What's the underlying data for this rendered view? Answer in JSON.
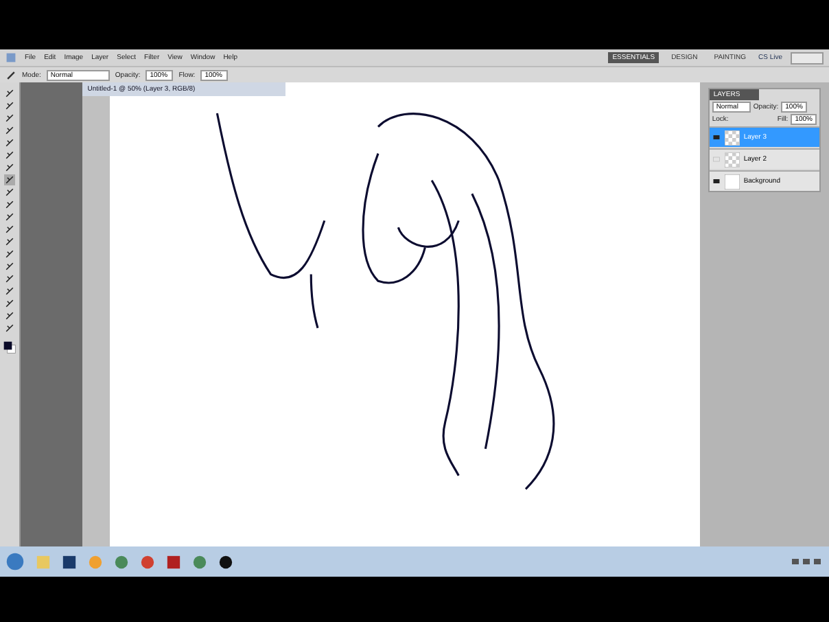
{
  "menu": [
    "File",
    "Edit",
    "Image",
    "Layer",
    "Select",
    "Filter",
    "View",
    "Window",
    "Help"
  ],
  "workspaces": [
    {
      "label": "ESSENTIALS",
      "selected": true
    },
    {
      "label": "DESIGN",
      "selected": false
    },
    {
      "label": "PAINTING",
      "selected": false
    }
  ],
  "cs_live": "CS Live",
  "options": {
    "mode_label": "Mode:",
    "mode": "Normal",
    "opacity_label": "Opacity:",
    "opacity": "100%",
    "flow_label": "Flow:",
    "flow": "100%"
  },
  "tools": [
    {
      "selected": false
    },
    {
      "selected": false
    },
    {
      "selected": false
    },
    {
      "selected": false
    },
    {
      "selected": false
    },
    {
      "selected": false
    },
    {
      "selected": false
    },
    {
      "selected": true
    },
    {
      "selected": false
    },
    {
      "selected": false
    },
    {
      "selected": false
    },
    {
      "selected": false
    },
    {
      "selected": false
    },
    {
      "selected": false
    },
    {
      "selected": false
    },
    {
      "selected": false
    },
    {
      "selected": false
    },
    {
      "selected": false
    },
    {
      "selected": false
    },
    {
      "selected": false
    }
  ],
  "document": {
    "title": "Untitled-1 @ 50% (Layer 3, RGB/8)"
  },
  "layers_panel": {
    "title": "LAYERS",
    "blend": "Normal",
    "opacity_label": "Opacity:",
    "opacity": "100%",
    "lock_label": "Lock:",
    "fill_label": "Fill:",
    "fill": "100%",
    "layers": [
      {
        "name": "Layer 3",
        "visible": true,
        "selected": true,
        "kind": "transparent"
      },
      {
        "name": "Layer 2",
        "visible": false,
        "selected": false,
        "kind": "transparent"
      },
      {
        "name": "Background",
        "visible": true,
        "selected": false,
        "kind": "fill"
      }
    ]
  },
  "taskbar": {
    "apps": [
      {
        "kind": "folder"
      },
      {
        "kind": "photoshop"
      },
      {
        "kind": "media"
      },
      {
        "kind": "ring"
      },
      {
        "kind": "browser"
      },
      {
        "kind": "ftp"
      },
      {
        "kind": "ring"
      },
      {
        "kind": "dark"
      }
    ]
  }
}
